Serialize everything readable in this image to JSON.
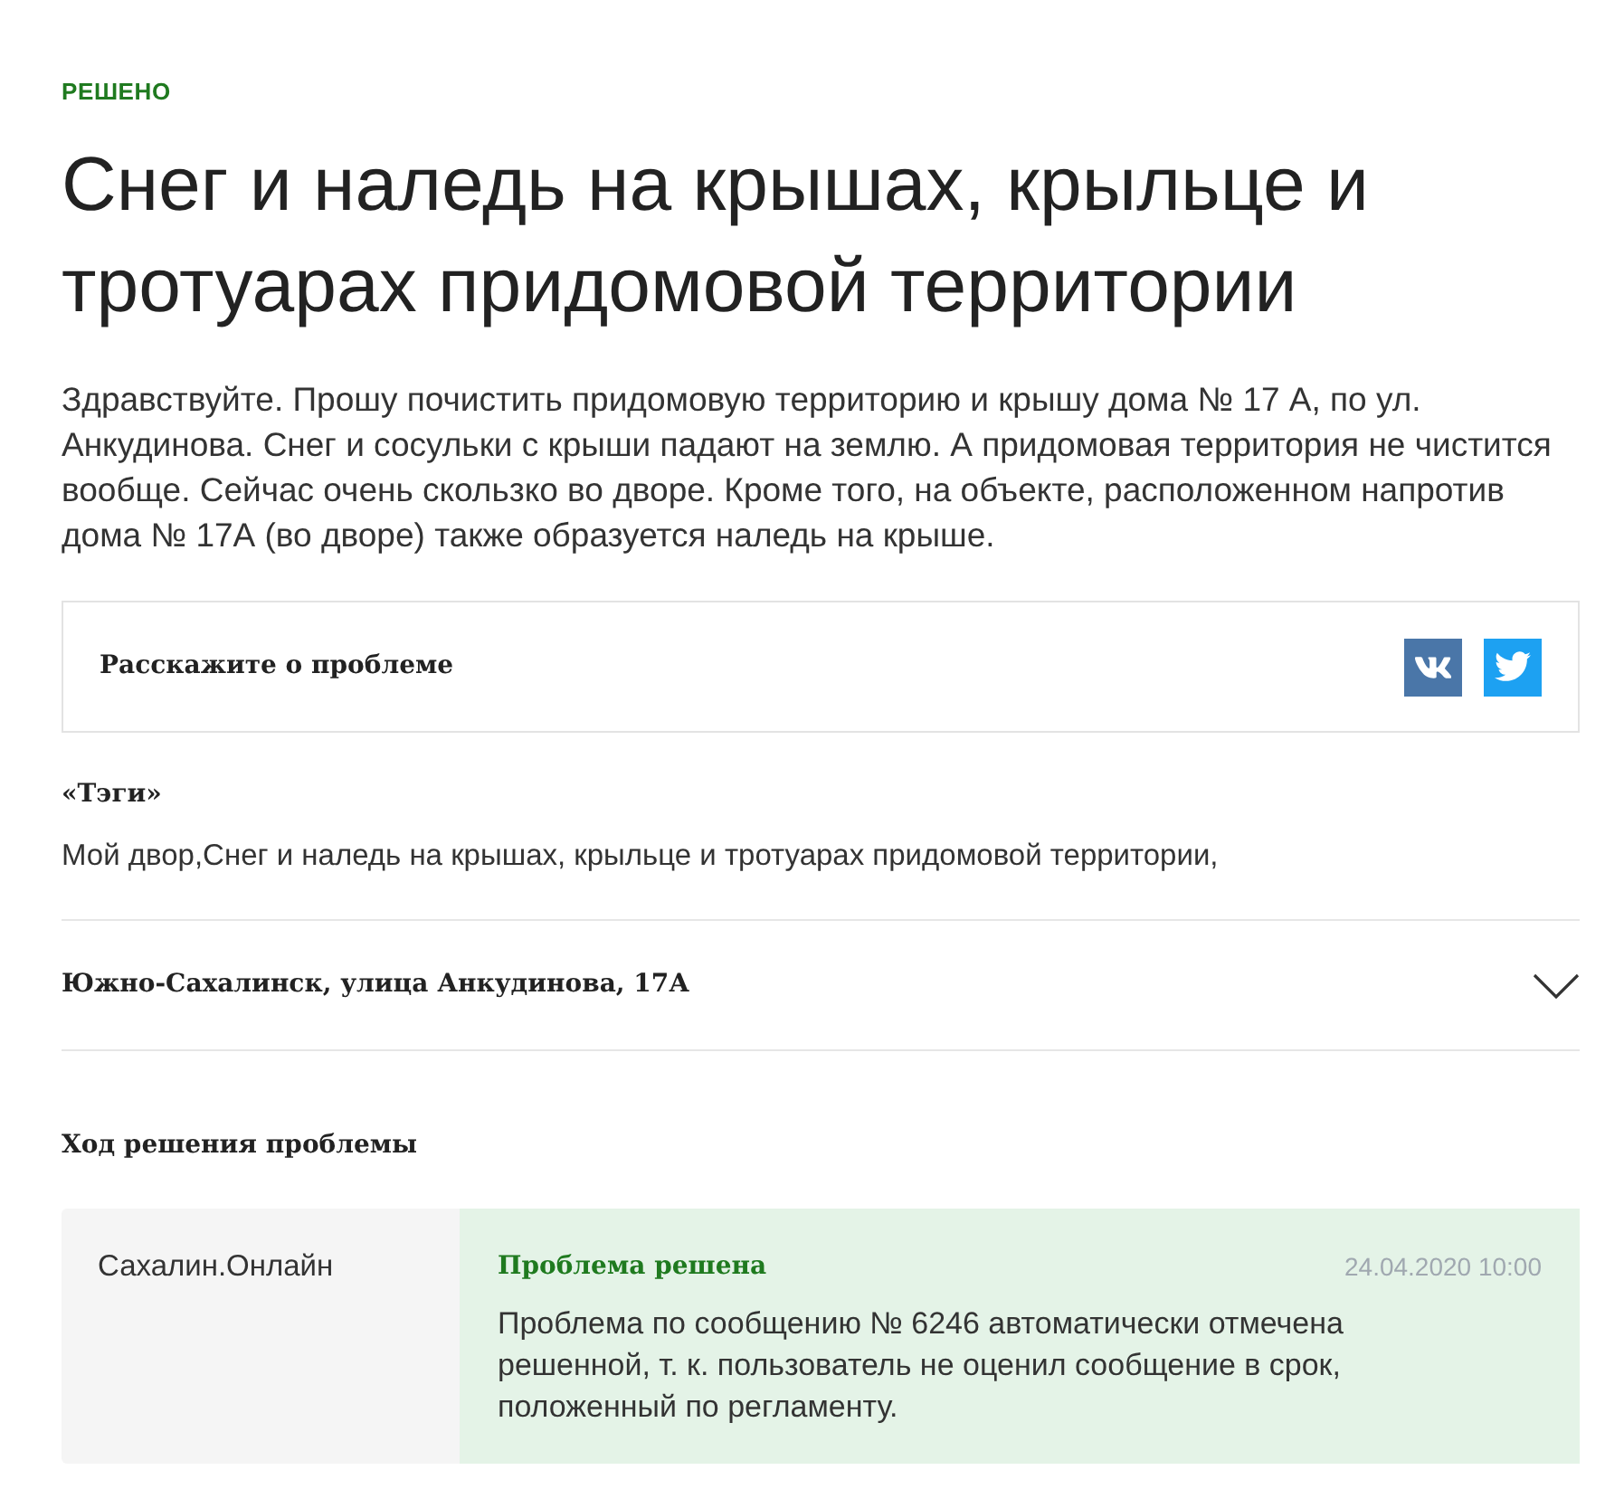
{
  "status": "РЕШЕНО",
  "title": "Снег и наледь на крышах, крыльце и тротуарах придомовой территории",
  "description": "Здравствуйте. Прошу почистить придомовую территорию и крышу дома № 17 А, по ул. Анкудинова. Снег и сосульки с крыши падают на землю. А придомовая территория не чистится вообще. Сейчас очень скользко во дворе. Кроме того, на объекте, расположенном напротив дома № 17А (во дворе) также образуется наледь на крыше.",
  "share": {
    "label": "Расскажите о проблеме",
    "buttons": [
      {
        "kind": "vk"
      },
      {
        "kind": "twitter"
      }
    ]
  },
  "tags": {
    "heading": "«Тэги»",
    "text": "Мой двор,Снег и наледь на крышах, крыльце и тротуарах придомовой территории,"
  },
  "address": {
    "text": "Южно-Сахалинск, улица Анкудинова, 17А",
    "expanded": false
  },
  "progress": {
    "heading": "Ход решения проблемы",
    "entries": [
      {
        "author": "Сахалин.Онлайн",
        "status": "Проблема решена",
        "date": "24.04.2020 10:00",
        "message": "Проблема по сообщению № 6246 автоматически отмечена решенной, т. к. пользователь не оценил сообщение в срок, положенный по регламенту."
      }
    ]
  }
}
